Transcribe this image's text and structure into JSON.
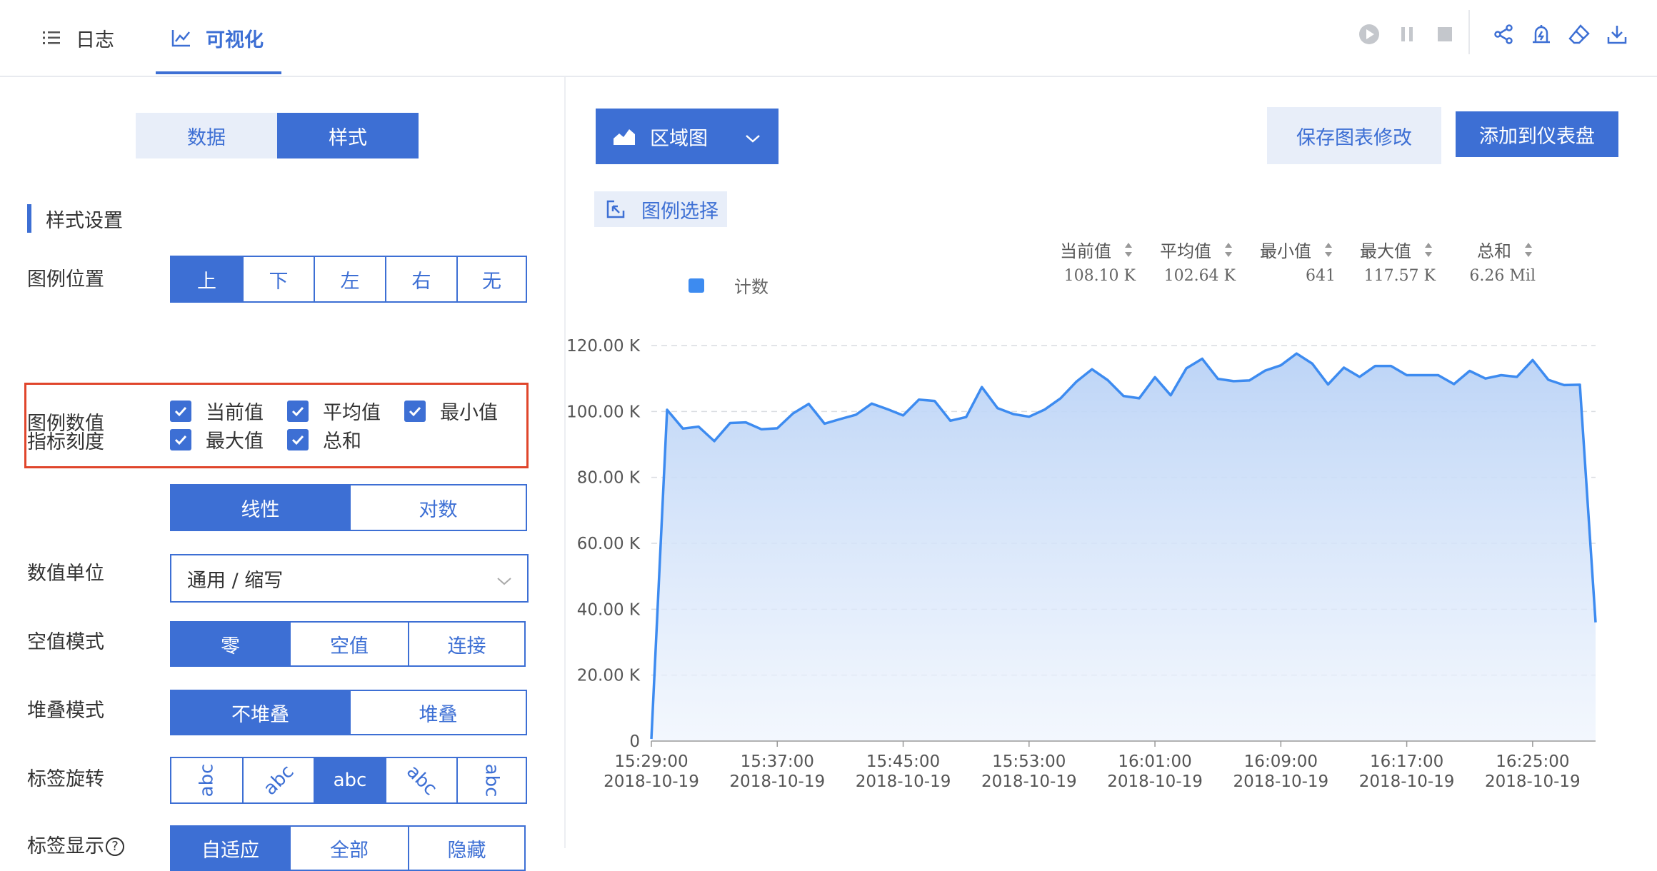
{
  "header": {
    "tabs": [
      {
        "label": "日志",
        "icon": "list-icon"
      },
      {
        "label": "可视化",
        "icon": "line-chart-icon"
      }
    ],
    "icons": [
      "play-icon",
      "pause-icon",
      "stop-icon",
      "share-icon",
      "alert-icon",
      "eraser-icon",
      "download-icon"
    ]
  },
  "left": {
    "toggle": [
      "数据",
      "样式"
    ],
    "section_title": "样式设置",
    "legend_position": {
      "label": "图例位置",
      "options": [
        "上",
        "下",
        "左",
        "右",
        "无"
      ],
      "selected": 0
    },
    "legend_values": {
      "label": "图例数值",
      "items": [
        "当前值",
        "平均值",
        "最小值",
        "最大值",
        "总和"
      ]
    },
    "metric_scale": {
      "label": "指标刻度",
      "options": [
        "线性",
        "对数"
      ],
      "selected": 0
    },
    "value_unit": {
      "label": "数值单位",
      "value": "通用 / 缩写"
    },
    "null_mode": {
      "label": "空值模式",
      "options": [
        "零",
        "空值",
        "连接"
      ],
      "selected": 0
    },
    "stack_mode": {
      "label": "堆叠模式",
      "options": [
        "不堆叠",
        "堆叠"
      ],
      "selected": 0
    },
    "label_rotation": {
      "label": "标签旋转",
      "sample": "abc",
      "selected": 2
    },
    "label_display": {
      "label": "标签显示",
      "help": "?",
      "options": [
        "自适应",
        "全部",
        "隐藏"
      ],
      "selected": 0
    }
  },
  "right": {
    "chart_type": "区域图",
    "save_button": "保存图表修改",
    "add_button": "添加到仪表盘",
    "legend_select": "图例选择",
    "stats_headers": [
      "当前值",
      "平均值",
      "最小值",
      "最大值",
      "总和"
    ],
    "series_name": "计数",
    "stats_values": [
      "108.10 K",
      "102.64 K",
      "641",
      "117.57 K",
      "6.26 Mil"
    ]
  },
  "colors": {
    "primary": "#3d6fd4",
    "line": "#3d8bf0",
    "highlight": "#e0452b"
  },
  "chart_data": {
    "type": "area",
    "series": [
      {
        "name": "计数",
        "values": [
          641,
          100500,
          94800,
          95400,
          91000,
          96500,
          96700,
          94600,
          94900,
          99400,
          102300,
          96300,
          97700,
          99000,
          102400,
          100700,
          98800,
          103600,
          103200,
          97200,
          98300,
          107400,
          101000,
          99200,
          98400,
          100600,
          104000,
          109000,
          112800,
          109500,
          104700,
          104000,
          110400,
          104900,
          113100,
          116000,
          109900,
          109200,
          109400,
          112400,
          114000,
          117570,
          114500,
          108200,
          113300,
          110500,
          113800,
          113800,
          111000,
          111000,
          111000,
          108300,
          112300,
          110000,
          111000,
          110500,
          115600,
          109600,
          108000,
          108100,
          36000
        ]
      }
    ],
    "x_ticks": [
      {
        "time": "15:29:00",
        "date": "2018-10-19",
        "index": 0
      },
      {
        "time": "15:37:00",
        "date": "2018-10-19",
        "index": 8
      },
      {
        "time": "15:45:00",
        "date": "2018-10-19",
        "index": 16
      },
      {
        "time": "15:53:00",
        "date": "2018-10-19",
        "index": 24
      },
      {
        "time": "16:01:00",
        "date": "2018-10-19",
        "index": 32
      },
      {
        "time": "16:09:00",
        "date": "2018-10-19",
        "index": 40
      },
      {
        "time": "16:17:00",
        "date": "2018-10-19",
        "index": 48
      },
      {
        "time": "16:25:00",
        "date": "2018-10-19",
        "index": 56
      }
    ],
    "y_ticks": [
      {
        "value": 0,
        "label": "0"
      },
      {
        "value": 20000,
        "label": "20.00 K"
      },
      {
        "value": 40000,
        "label": "40.00 K"
      },
      {
        "value": 60000,
        "label": "60.00 K"
      },
      {
        "value": 80000,
        "label": "80.00 K"
      },
      {
        "value": 100000,
        "label": "100.00 K"
      },
      {
        "value": 120000,
        "label": "120.00 K"
      }
    ],
    "ylim": [
      0,
      120000
    ],
    "grid": true
  }
}
